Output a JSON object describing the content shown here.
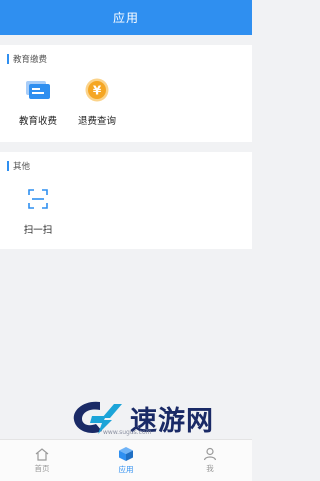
{
  "header": {
    "title": "应用"
  },
  "sections": [
    {
      "title": "教育缴费",
      "items": [
        {
          "label": "教育收费",
          "icon": "card-icon"
        },
        {
          "label": "退费查询",
          "icon": "yuan-coin-icon"
        }
      ]
    },
    {
      "title": "其他",
      "items": [
        {
          "label": "扫一扫",
          "icon": "scan-icon"
        }
      ]
    }
  ],
  "tabbar": {
    "items": [
      {
        "label": "首页",
        "icon": "home-icon",
        "active": false
      },
      {
        "label": "应用",
        "icon": "cube-icon",
        "active": true
      },
      {
        "label": "我",
        "icon": "user-icon",
        "active": false
      }
    ]
  },
  "watermark": {
    "text": "速游网",
    "url": "www.sugus.com"
  },
  "colors": {
    "primary": "#2f8ff0",
    "orange": "#f5a623",
    "navy": "#1a2a66"
  }
}
